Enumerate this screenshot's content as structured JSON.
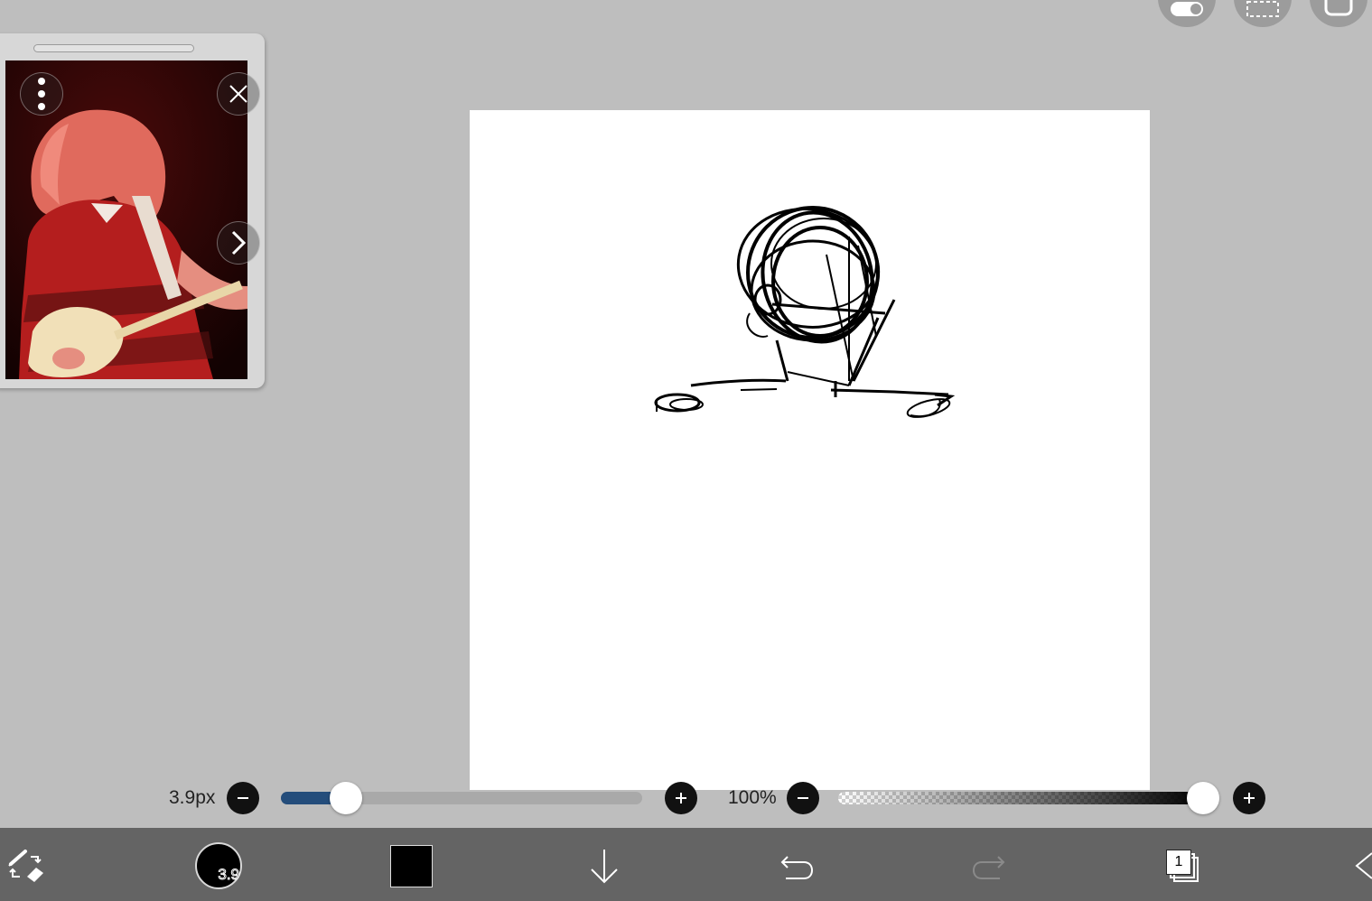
{
  "top_buttons": [
    {
      "name": "toggle-icon"
    },
    {
      "name": "selection-icon"
    },
    {
      "name": "fullscreen-icon"
    }
  ],
  "reference_panel": {
    "menu_icon": "more-vertical-icon",
    "close_icon": "close-icon",
    "next_icon": "chevron-right-icon",
    "photo_description_icon": "reference-photo"
  },
  "sliders": {
    "brush_size": {
      "label": "3.9px",
      "value_fraction": 0.135
    },
    "opacity": {
      "label": "100%",
      "value_fraction": 1.0
    }
  },
  "toolbar": {
    "tool_switch_icon": "brush-eraser-swap-icon",
    "brush_size_badge": "3.9",
    "current_color": "#000000",
    "download_icon": "arrow-down-icon",
    "undo_icon": "undo-icon",
    "redo_icon": "redo-icon",
    "layer_count": "1",
    "collapse_icon": "chevron-left-icon"
  },
  "colors": {
    "background": "#bebebe",
    "toolbar": "#646464",
    "slider_fill": "#244d7b",
    "canvas": "#ffffff"
  }
}
